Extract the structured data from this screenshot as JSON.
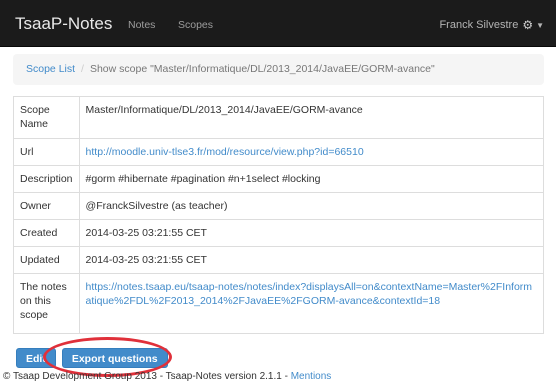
{
  "navbar": {
    "brand": "TsaaP-Notes",
    "links": [
      "Notes",
      "Scopes"
    ],
    "user": "Franck Silvestre"
  },
  "breadcrumb": {
    "link": "Scope List",
    "separator": "/",
    "current": "Show scope \"Master/Informatique/DL/2013_2014/JavaEE/GORM-avance\""
  },
  "details": [
    {
      "label": "Scope Name",
      "value": "Master/Informatique/DL/2013_2014/JavaEE/GORM-avance"
    },
    {
      "label": "Url",
      "value": "http://moodle.univ-tlse3.fr/mod/resource/view.php?id=66510"
    },
    {
      "label": "Description",
      "value": "#gorm #hibernate #pagination #n+1select #locking"
    },
    {
      "label": "Owner",
      "value": "@FranckSilvestre (as teacher)"
    },
    {
      "label": "Created",
      "value": "2014-03-25 03:21:55 CET"
    },
    {
      "label": "Updated",
      "value": "2014-03-25 03:21:55 CET"
    },
    {
      "label": "The notes on this scope",
      "value": "https://notes.tsaap.eu/tsaap-notes/notes/index?displaysAll=on&contextName=Master%2FInformatique%2FDL%2F2013_2014%2FJavaEE%2FGORM-avance&contextId=18"
    }
  ],
  "actions": {
    "edit": "Edit",
    "export": "Export questions"
  },
  "footer": {
    "text": "© Tsaap Development Group 2013 - Tsaap-Notes version 2.1.1 - ",
    "link": "Mentions"
  },
  "colors": {
    "navbar_bg": "#1b1b1b",
    "link": "#428bca",
    "button": "#428bca",
    "highlight": "#e0303a"
  },
  "icons": [
    "gear-icon",
    "caret-down-icon"
  ]
}
